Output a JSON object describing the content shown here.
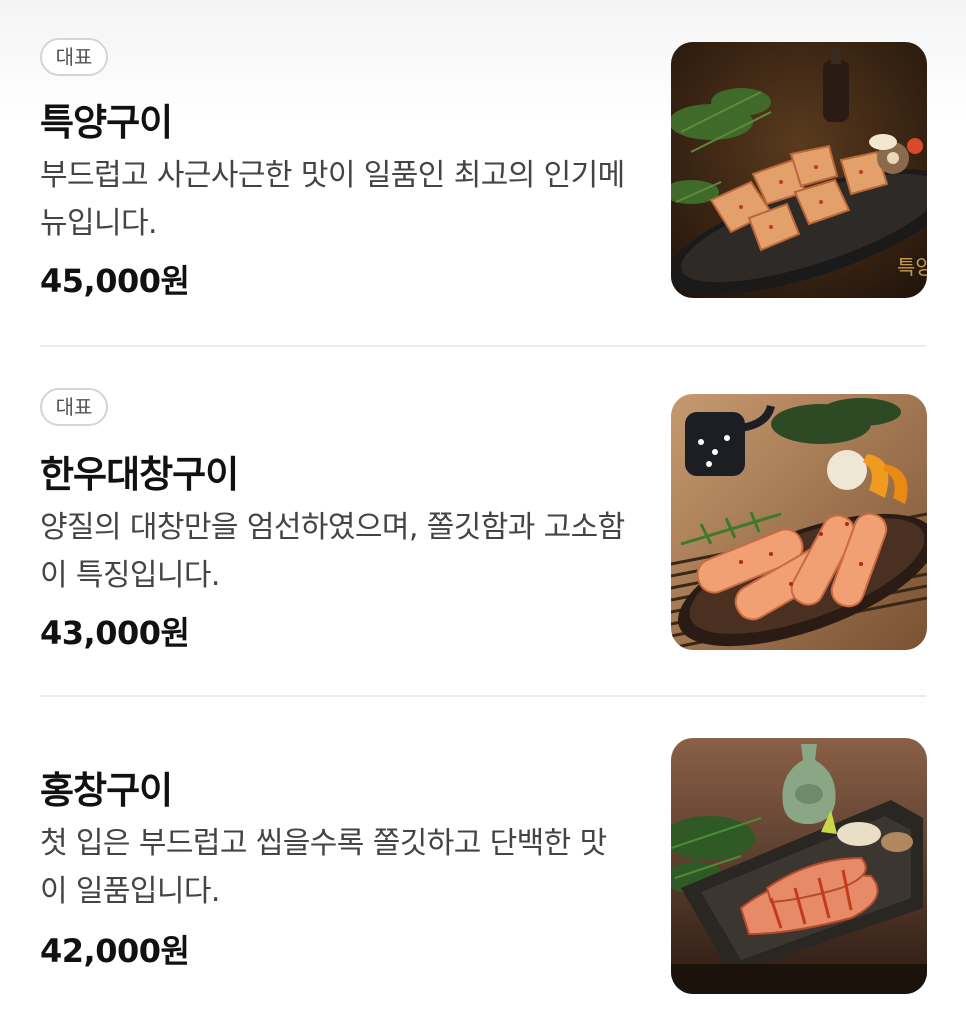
{
  "menu": {
    "items": [
      {
        "badge": "대표",
        "name": "특양구이",
        "description": "부드럽고 사근사근한 맛이 일품인 최고의 인기메뉴입니다.",
        "price": "45,000원",
        "image_caption": "특양"
      },
      {
        "badge": "대표",
        "name": "한우대창구이",
        "description": "양질의 대창만을 엄선하였으며, 쫄깃함과 고소함이 특징입니다.",
        "price": "43,000원"
      },
      {
        "name": "홍창구이",
        "description": "첫 입은 부드럽고 씹을수록 쫄깃하고 단백한 맛이 일품입니다.",
        "price": "42,000원"
      }
    ]
  },
  "colors": {
    "badge_border": "#d5d5d5",
    "divider": "#ececec",
    "text_primary": "#111111",
    "text_secondary": "#444444"
  }
}
